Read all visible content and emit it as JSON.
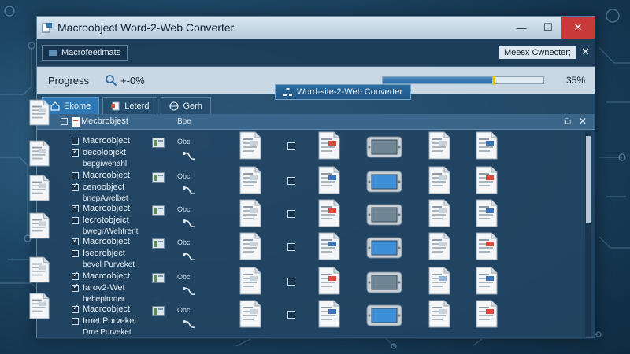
{
  "window": {
    "title": "Macroobject Word-2-Web Converter",
    "controls": {
      "minimize": "—",
      "maximize": "☐",
      "close": "✕"
    }
  },
  "menubar": {
    "box_label": "Macrofeetlmats",
    "sub_window_label": "Meesx Cwnecter;",
    "sub_close": "✕"
  },
  "progress": {
    "label": "Progress",
    "small_value": "+-0%",
    "percent_text": "35%",
    "value": 0.68,
    "marker": 0.68
  },
  "tabs": [
    {
      "label": "Ekome",
      "icon": "home-icon",
      "active": true
    },
    {
      "label": "Leterd",
      "icon": "document-icon",
      "active": false
    },
    {
      "label": "Gerh",
      "icon": "globe-icon",
      "active": false
    }
  ],
  "inner_title": "Word-site-2-Web Converter",
  "content_header": {
    "name": "Mecbrobjest",
    "type": "Bbe",
    "ctrl_restore": "⧉",
    "ctrl_close": "✕"
  },
  "rows": [
    {
      "label": "Macroobject",
      "checked": false,
      "type": "Obc"
    },
    {
      "label": "oecolobjckt",
      "checked": true,
      "type": ""
    },
    {
      "label": "Macroobject",
      "checked": false,
      "type": "Obc"
    },
    {
      "label": "cenoobject",
      "checked": true,
      "type": ""
    },
    {
      "label": "Macroobject",
      "checked": true,
      "type": "Obc"
    },
    {
      "label": "lecrotobjeict",
      "checked": false,
      "type": ""
    },
    {
      "label": "Macroobject",
      "checked": true,
      "type": "Obc"
    },
    {
      "label": "Iseorobject",
      "checked": false,
      "type": ""
    },
    {
      "label": "Macroobject",
      "checked": true,
      "type": "Obc"
    },
    {
      "label": "Iarov2-Wet",
      "checked": true,
      "type": ""
    },
    {
      "label": "Macroobject",
      "checked": true,
      "type": "Ohc"
    },
    {
      "label": "Irnet Porveket",
      "checked": false,
      "type": ""
    }
  ],
  "sublabels": [
    "bepgiwenahl",
    "bnepAwelbet",
    "bwegr/Wehtrent",
    "bevel Purveket",
    "bebeplroder",
    "Drre Purveket"
  ],
  "colors": {
    "accent": "#2d77b4",
    "close": "#c8393a",
    "marker": "#e4c21a"
  }
}
